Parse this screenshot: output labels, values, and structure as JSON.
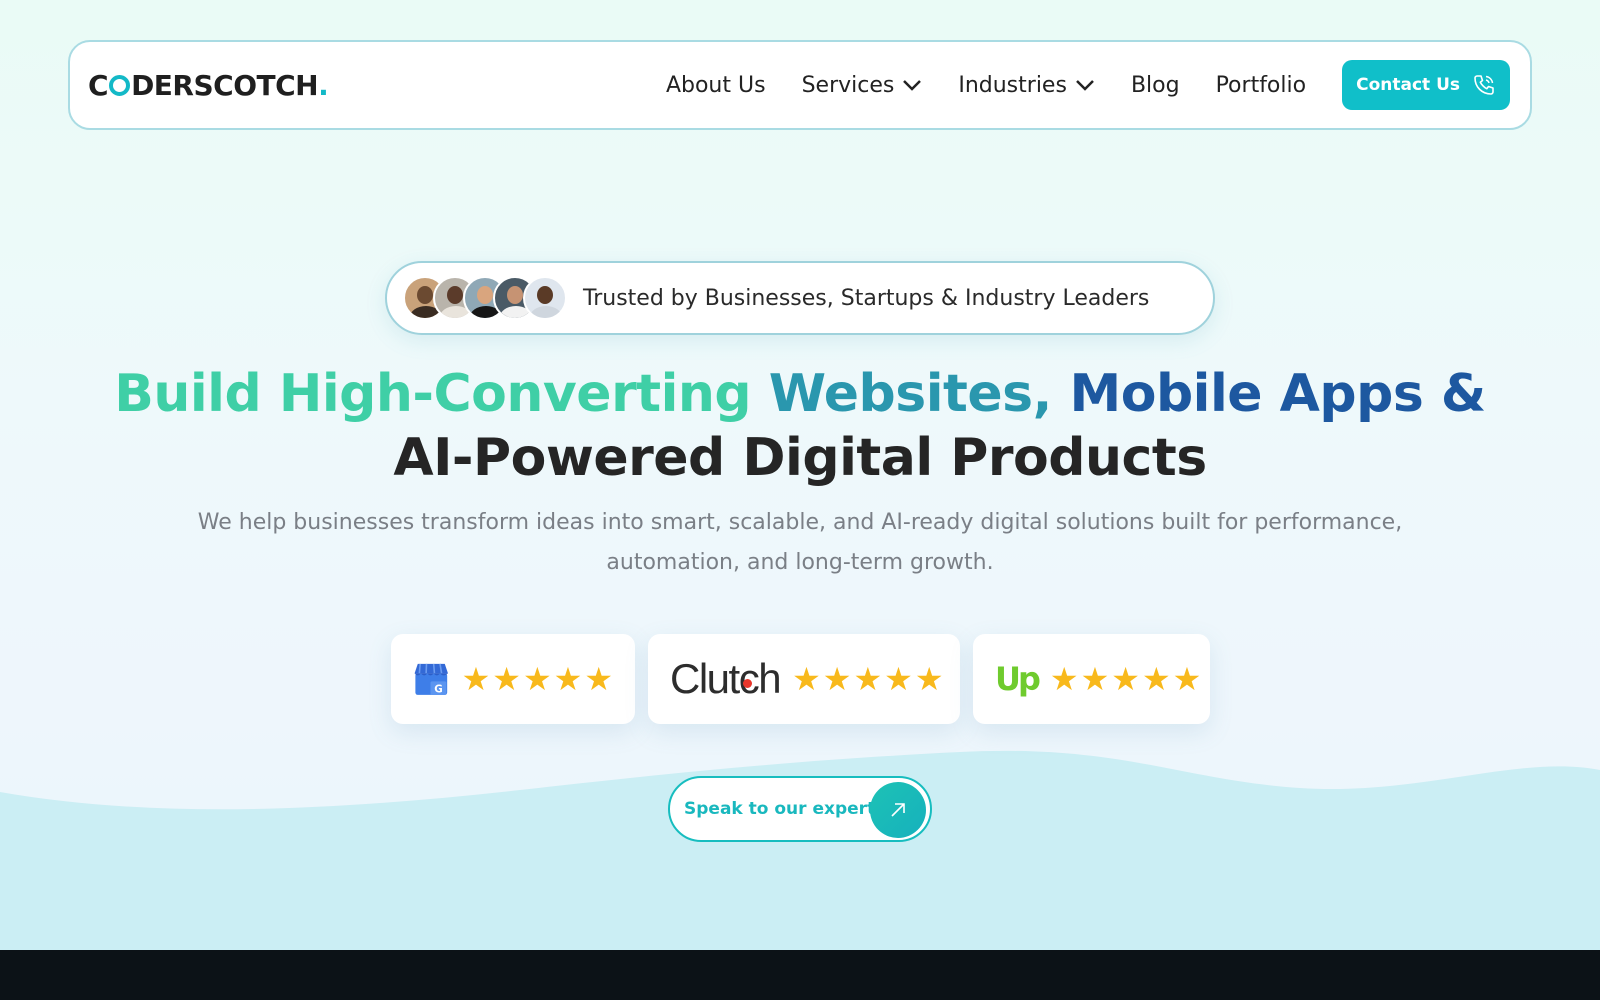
{
  "brand": {
    "logo_prefix": "C",
    "logo_suffix": "DERSCOTCH",
    "logo_dot": ".",
    "accent_color": "#13b9c7"
  },
  "nav": {
    "items": [
      {
        "label": "About Us",
        "has_dropdown": false
      },
      {
        "label": "Services",
        "has_dropdown": true
      },
      {
        "label": "Industries",
        "has_dropdown": true
      },
      {
        "label": "Blog",
        "has_dropdown": false
      },
      {
        "label": "Portfolio",
        "has_dropdown": false
      }
    ],
    "contact_label": "Contact Us",
    "contact_icon": "phone-icon"
  },
  "trust": {
    "text": "Trusted by Businesses, Startups & Industry Leaders",
    "avatar_count": 5
  },
  "hero": {
    "headline_part1": "Build High-Converting",
    "headline_part2": "Websites,",
    "headline_part3": "Mobile Apps &",
    "headline_line2": "AI-Powered Digital Products",
    "subtext": "We help businesses transform ideas into smart, scalable, and AI-ready digital solutions built for performance, automation, and long-term growth.",
    "colors": {
      "green": "#3fcfa6",
      "teal": "#2a97ae",
      "blue": "#1d58a0"
    }
  },
  "ratings": [
    {
      "platform": "Google Business Profile",
      "icon": "google-business-icon",
      "stars": 5
    },
    {
      "platform": "Clutch",
      "logo_text": "Clutch",
      "stars": 5
    },
    {
      "platform": "Upwork",
      "logo_text": "Up",
      "stars": 5
    }
  ],
  "cta": {
    "label": "Speak to our expert",
    "icon": "arrow-up-right-icon"
  }
}
